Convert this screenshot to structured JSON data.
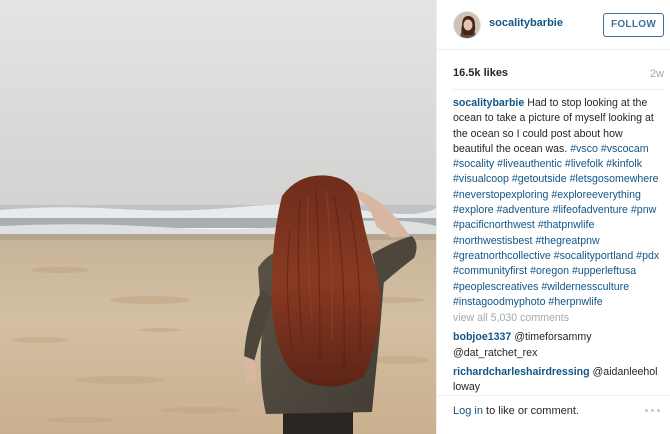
{
  "post": {
    "username": "socalitybarbie",
    "follow_label": "FOLLOW",
    "likes": "16.5k likes",
    "age": "2w",
    "caption_text": " Had to stop looking at the ocean to take a picture of myself looking at the ocean so I could post about how beautiful the ocean was. ",
    "hashtags": [
      "#vsco",
      "#vscocam",
      "#socality",
      "#liveauthentic",
      "#livefolk",
      "#kinfolk",
      "#visualcoop",
      "#getoutside",
      "#letsgosomewhere",
      "#neverstopexploring",
      "#exploreeverything",
      "#explore",
      "#adventure",
      "#lifeofadventure",
      "#pnw",
      "#pacificnorthwest",
      "#thatpnwlife",
      "#northwestisbest",
      "#thegreatpnw",
      "#greatnorthcollective",
      "#socalityportland",
      "#pdx",
      "#communityfirst",
      "#oregon",
      "#upperleftusa",
      "#peoplescreatives",
      "#wildernessculture",
      "#instagoodmyphoto",
      "#herpnwlife"
    ],
    "view_all_comments": "view all 5,030 comments",
    "comments": [
      {
        "user": "bobjoe1337",
        "text": " @timeforsammy @dat_ratchet_rex"
      },
      {
        "user": "richardcharleshairdressing",
        "text": " @aidanleehol loway"
      }
    ],
    "footer": {
      "login_link": "Log in",
      "login_rest": " to like or comment."
    }
  },
  "colors": {
    "link_blue": "#125688",
    "follow_blue": "#3f729b",
    "muted_gray": "#a5a7aa",
    "text_dark": "#262626"
  },
  "icons": {
    "more_options": "three-dots-icon"
  }
}
